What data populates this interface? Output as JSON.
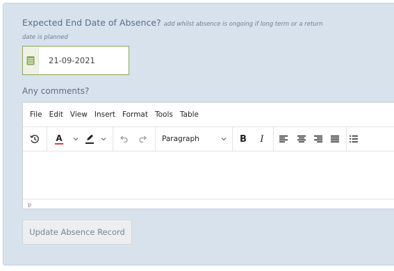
{
  "form": {
    "question": "Expected End Date of Absence?",
    "hint_a": "add whilst absence is ongoing if long term or a return",
    "hint_b": "date is planned",
    "date_value": "21-09-2021",
    "comments_label": "Any comments?",
    "submit_label": "Update Absence Record"
  },
  "editor": {
    "menu": [
      "File",
      "Edit",
      "View",
      "Insert",
      "Format",
      "Tools",
      "Table"
    ],
    "block_format": "Paragraph",
    "bold": "B",
    "italic": "I",
    "text_color_letter": "A",
    "status_path": "p"
  },
  "colors": {
    "panel_bg": "#d8e2ec",
    "date_border": "#8aa65a",
    "calendar_icon": "#8aa65a",
    "text_color_bar": "#e03e2d",
    "button_bg": "#eceeef"
  },
  "icons": {
    "calendar": "calendar-icon",
    "history": "history-icon",
    "undo": "undo-icon",
    "redo": "redo-icon"
  }
}
